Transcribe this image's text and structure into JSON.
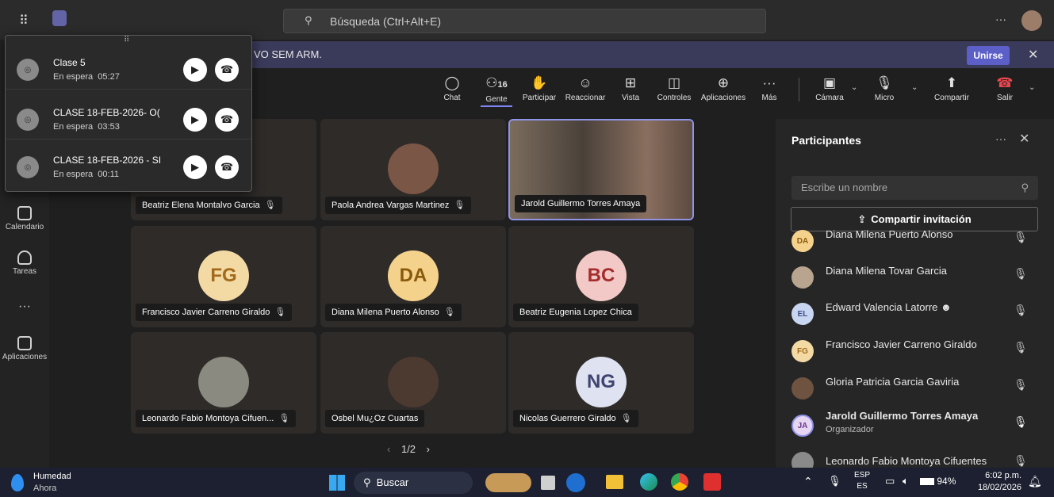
{
  "topbar": {
    "search_placeholder": "Búsqueda (Ctrl+Alt+E)",
    "more": "···"
  },
  "banner": {
    "text": "VO SEM ARM.",
    "join_label": "Unirse",
    "close": "✕"
  },
  "rail": [
    {
      "label": "Calendario",
      "icon": "calendar-icon"
    },
    {
      "label": "Tareas",
      "icon": "tasks-icon"
    },
    {
      "label": "···",
      "icon": "more-icon"
    },
    {
      "label": "Aplicaciones",
      "icon": "apps-icon"
    }
  ],
  "toolbar": {
    "chat": "Chat",
    "people": "Gente",
    "people_count": "16",
    "raise": "Participar",
    "react": "Reaccionar",
    "view": "Vista",
    "controls": "Controles",
    "apps": "Aplicaciones",
    "more": "Más",
    "camera": "Cámara",
    "mic": "Micro",
    "share": "Compartir",
    "leave": "Salir"
  },
  "tiles": [
    {
      "name": "Beatriz Elena Montalvo Garcia",
      "initials": "",
      "color": "",
      "muted": true
    },
    {
      "name": "Paola Andrea Vargas Martinez",
      "initials": "",
      "color": "",
      "muted": true
    },
    {
      "name": "Jarold Guillermo Torres Amaya",
      "initials": "",
      "color": "",
      "muted": false
    },
    {
      "name": "Francisco Javier Carreno Giraldo",
      "initials": "FG",
      "color": "#f3d9a4",
      "muted": true
    },
    {
      "name": "Diana Milena Puerto Alonso",
      "initials": "DA",
      "color": "#f5d28c",
      "muted": true
    },
    {
      "name": "Beatriz Eugenia Lopez Chica",
      "initials": "BC",
      "color": "#f3c9c7",
      "muted": false
    },
    {
      "name": "Leonardo Fabio Montoya Cifuen...",
      "initials": "",
      "color": "",
      "muted": true
    },
    {
      "name": "Osbel Mu¿Oz Cuartas",
      "initials": "",
      "color": "",
      "muted": false
    },
    {
      "name": "Nicolas Guerrero Giraldo",
      "initials": "NG",
      "color": "#dfe2f0",
      "muted": true
    }
  ],
  "pagination": {
    "prev": "‹",
    "label": "1/2",
    "next": "›"
  },
  "panel": {
    "title": "Participantes",
    "search_placeholder": "Escribe un nombre",
    "invite_label": "Compartir invitación",
    "participants": [
      {
        "initials": "DA",
        "name": "Diana Milena Puerto Alonso",
        "role": "",
        "color": "#f5d28c"
      },
      {
        "initials": "",
        "name": "Diana Milena Tovar Garcia",
        "role": "",
        "color": "#b8a48f"
      },
      {
        "initials": "EL",
        "name": "Edward Valencia Latorre",
        "role": "",
        "color": "#c9d6f1"
      },
      {
        "initials": "FG",
        "name": "Francisco Javier Carreno Giraldo",
        "role": "",
        "color": "#f3d9a4"
      },
      {
        "initials": "",
        "name": "Gloria Patricia Garcia Gaviria",
        "role": "",
        "color": "#6e5340"
      },
      {
        "initials": "JA",
        "name": "Jarold Guillermo Torres Amaya",
        "role": "Organizador",
        "color": "#e6d6f2"
      },
      {
        "initials": "",
        "name": "Leonardo Fabio Montoya Cifuentes",
        "role": "",
        "color": "#8a8a8a"
      }
    ]
  },
  "waiting": {
    "items": [
      {
        "title": "Clase 5",
        "status": "En espera",
        "time": "05:27"
      },
      {
        "title": "CLASE 18-FEB-2026- O(",
        "status": "En espera",
        "time": "03:53"
      },
      {
        "title": "CLASE 18-FEB-2026 - SI",
        "status": "En espera",
        "time": "00:11"
      }
    ]
  },
  "taskbar": {
    "weather_title": "Humedad",
    "weather_sub": "Ahora",
    "search": "Buscar",
    "lang_top": "ESP",
    "lang_bottom": "ES",
    "battery": "94%",
    "time": "6:02 p.m.",
    "date": "18/02/2026"
  }
}
